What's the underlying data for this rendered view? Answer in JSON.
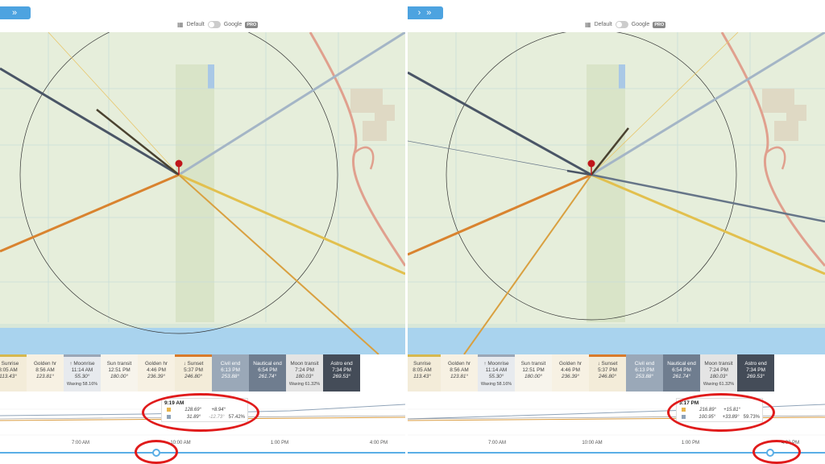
{
  "left": {
    "nav_label": "»",
    "map_type": {
      "default_label": "Default",
      "google_label": "Google",
      "pro_badge": "PRO"
    },
    "events": [
      {
        "label": "↑ Sunrise",
        "time": "8:05 AM",
        "value": "113.43°",
        "kind": "sunrise"
      },
      {
        "label": "Golden hr",
        "time": "8:56 AM",
        "value": "123.81°",
        "kind": "golden"
      },
      {
        "label": "↑ Moonrise",
        "time": "11:14 AM",
        "value": "55.30°",
        "extra": "Waxing 58.16%",
        "kind": "moonrise"
      },
      {
        "label": "Sun transit",
        "time": "12:51 PM",
        "value": "180.00°",
        "kind": "transit"
      },
      {
        "label": "Golden hr",
        "time": "4:46 PM",
        "value": "236.39°",
        "kind": "golden"
      },
      {
        "label": "↓ Sunset",
        "time": "5:37 PM",
        "value": "246.80°",
        "kind": "sunset"
      },
      {
        "label": "Civil end",
        "time": "6:13 PM",
        "value": "253.88°",
        "kind": "civil"
      },
      {
        "label": "Nautical end",
        "time": "6:54 PM",
        "value": "261.74°",
        "kind": "nautical"
      },
      {
        "label": "Moon transit",
        "time": "7:24 PM",
        "value": "180.03°",
        "extra": "Waxing 61.32%",
        "kind": "moontr"
      },
      {
        "label": "Astro end",
        "time": "7:34 PM",
        "value": "269.53°",
        "kind": "astro"
      }
    ],
    "tooltip": {
      "time": "9:19 AM",
      "sun": {
        "azimuth": "128.69°",
        "altitude": "+8.94°"
      },
      "moon": {
        "azimuth": "31.89°",
        "altitude": "-12.73°",
        "illumination": "57.42%"
      }
    },
    "ticks": [
      "7:00 AM",
      "10:00 AM",
      "1:00 PM",
      "4:00 PM"
    ],
    "slider_position": 0.386
  },
  "right": {
    "nav_label": "› »",
    "map_type": {
      "default_label": "Default",
      "google_label": "Google",
      "pro_badge": "PRO"
    },
    "events": [
      {
        "label": "Sunrise",
        "time": "8:05 AM",
        "value": "113.43°",
        "kind": "sunrise"
      },
      {
        "label": "Golden hr",
        "time": "8:56 AM",
        "value": "123.81°",
        "kind": "golden"
      },
      {
        "label": "↑ Moonrise",
        "time": "11:14 AM",
        "value": "55.30°",
        "extra": "Waxing 58.16%",
        "kind": "moonrise"
      },
      {
        "label": "Sun transit",
        "time": "12:51 PM",
        "value": "180.00°",
        "kind": "transit"
      },
      {
        "label": "Golden hr",
        "time": "4:46 PM",
        "value": "236.39°",
        "kind": "golden"
      },
      {
        "label": "↓ Sunset",
        "time": "5:37 PM",
        "value": "246.80°",
        "kind": "sunset"
      },
      {
        "label": "Civil end",
        "time": "6:13 PM",
        "value": "253.88°",
        "kind": "civil"
      },
      {
        "label": "Nautical end",
        "time": "6:54 PM",
        "value": "261.74°",
        "kind": "nautical"
      },
      {
        "label": "Moon transit",
        "time": "7:24 PM",
        "value": "180.03°",
        "extra": "Waxing 61.32%",
        "kind": "moontr"
      },
      {
        "label": "Astro end",
        "time": "7:34 PM",
        "value": "269.53°",
        "kind": "astro"
      }
    ],
    "tooltip": {
      "time": "3:17 PM",
      "sun": {
        "azimuth": "216.89°",
        "altitude": "+15.81°"
      },
      "moon": {
        "azimuth": "100.95°",
        "altitude": "+33.89°",
        "illumination": "59.73%"
      }
    },
    "ticks": [
      "7:00 AM",
      "10:00 AM",
      "1:00 PM",
      "4:00 PM"
    ],
    "slider_position": 0.869
  },
  "colors": {
    "accent": "#4da3e0",
    "sun": "#e8b54a",
    "moon": "#8fa3b8",
    "sunrise_line": "#e2c04e",
    "sunset_line": "#d9832f",
    "highlight_ring": "#e01b1b"
  },
  "icons": {
    "map_icon": "map-icon",
    "pin": "location-pin-icon"
  }
}
